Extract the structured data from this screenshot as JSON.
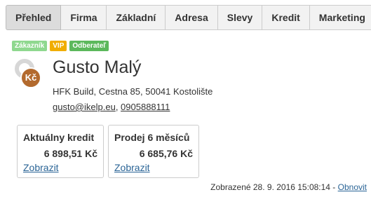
{
  "tabs": [
    {
      "label": "Přehled",
      "active": true
    },
    {
      "label": "Firma"
    },
    {
      "label": "Základní"
    },
    {
      "label": "Adresa"
    },
    {
      "label": "Slevy"
    },
    {
      "label": "Kredit"
    },
    {
      "label": "Marketing"
    }
  ],
  "badges": [
    {
      "label": "Zákazník",
      "color": "#8fd88f"
    },
    {
      "label": "VIP",
      "color": "#f0ad00"
    },
    {
      "label": "Odberateľ",
      "color": "#5cb85c"
    }
  ],
  "customer": {
    "avatar_text": "Kč",
    "name": "Gusto Malý",
    "address": "HFK Build, Cestna 85, 50041 Kostolište",
    "email": "gusto@ikelp.eu",
    "separator": ", ",
    "phone": "0905888111"
  },
  "cards": [
    {
      "title": "Aktuálny kredit",
      "value": "6 898,51 Kč",
      "link": "Zobrazit"
    },
    {
      "title": "Prodej 6 měsíců",
      "value": "6 685,76 Kč",
      "link": "Zobrazit"
    }
  ],
  "footer": {
    "text": "Zobrazené 28. 9. 2016 15:08:14 - ",
    "refresh_label": "Obnovit"
  },
  "colors": {
    "link": "#2a6496",
    "avatar_coin": "#b36a2e"
  }
}
